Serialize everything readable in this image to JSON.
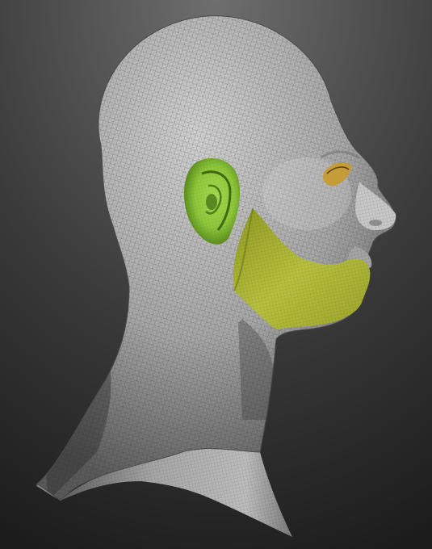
{
  "scene": {
    "subject": "head-mesh",
    "background_top": "#6e6e6e",
    "background_bottom": "#1b1b1b",
    "mesh_color": "#b4b4b4",
    "mesh_shadow": "#3a3a3a",
    "wire_color": "#2a2a2a",
    "ear_color": "#8cc63a",
    "ear_shadow": "#4f7f16",
    "beard_color": "#b2ba3a",
    "beard_shadow": "#6f7a1a",
    "eye_color": "#c99a2e",
    "masked_regions": [
      "ear",
      "beard-jaw",
      "eye"
    ]
  }
}
